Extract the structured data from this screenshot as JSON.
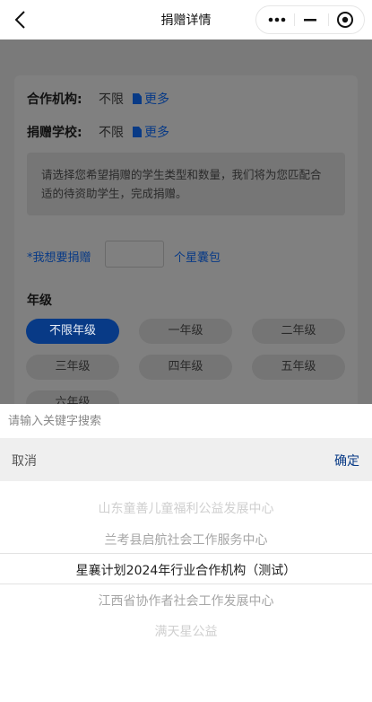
{
  "header": {
    "title": "捐赠详情"
  },
  "form": {
    "org_label": "合作机构:",
    "org_value": "不限",
    "org_more": "更多",
    "school_label": "捐赠学校:",
    "school_value": "不限",
    "school_more": "更多",
    "hint": "请选择您希望捐赠的学生类型和数量，我们将为您匹配合适的待资助学生，完成捐赠。",
    "want_label": "*我想要捐赠",
    "want_unit": "个星囊包",
    "grade_title": "年级",
    "grades": [
      "不限年级",
      "一年级",
      "二年级",
      "三年级",
      "四年级",
      "五年级",
      "六年级"
    ],
    "selected_grade": "不限年级"
  },
  "sheet": {
    "search_placeholder": "请输入关键字搜索",
    "cancel": "取消",
    "confirm": "确定",
    "options": [
      "山东童善儿童福利公益发展中心",
      "兰考县启航社会工作服务中心",
      "星襄计划2024年行业合作机构（测试）",
      "江西省协作者社会工作发展中心",
      "满天星公益"
    ],
    "selected_option": "星襄计划2024年行业合作机构（测试）"
  },
  "colors": {
    "accent": "#083a86",
    "header_bg": "#ffffff",
    "dim_bg": "#7f7f7f"
  }
}
